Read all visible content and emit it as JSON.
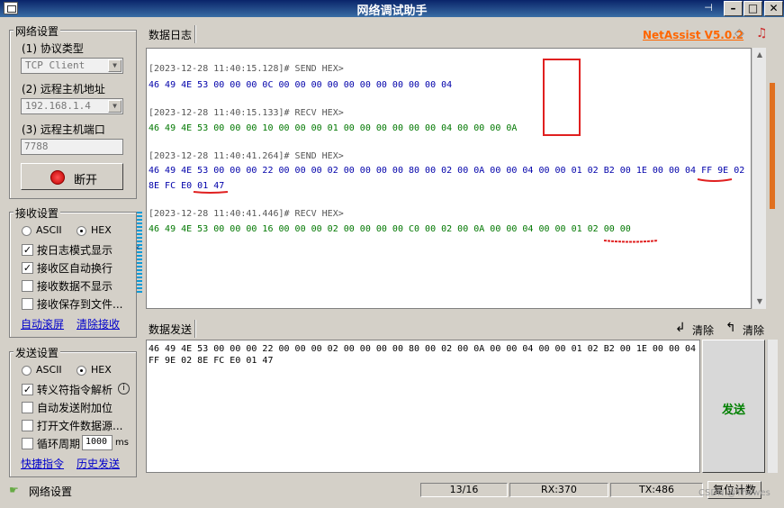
{
  "window": {
    "title": "网络调试助手",
    "minimize": "–",
    "maximize": "□",
    "close": "✕"
  },
  "app_version": "NetAssist V5.0.2",
  "network": {
    "legend": "网络设置",
    "protocol_label": "(1) 协议类型",
    "protocol_value": "TCP Client",
    "host_label": "(2) 远程主机地址",
    "host_value": "192.168.1.4",
    "port_label": "(3) 远程主机端口",
    "port_value": "7788",
    "disconnect_label": "断开"
  },
  "recv_settings": {
    "legend": "接收设置",
    "ascii": "ASCII",
    "hex": "HEX",
    "opt_log_mode": "按日志模式显示",
    "opt_auto_wrap": "接收区自动换行",
    "opt_hide_data": "接收数据不显示",
    "opt_save_file": "接收保存到文件...",
    "auto_scroll": "自动滚屏",
    "clear_recv": "清除接收"
  },
  "send_settings": {
    "legend": "发送设置",
    "ascii": "ASCII",
    "hex": "HEX",
    "opt_escape": "转义符指令解析",
    "opt_checksum": "自动发送附加位",
    "opt_open_file": "打开文件数据源...",
    "opt_cycle": "循环周期",
    "cycle_value": "1000",
    "cycle_unit": "ms",
    "shortcut": "快捷指令",
    "history": "历史发送"
  },
  "log": {
    "tab": "数据日志",
    "entries": [
      {
        "header": "[2023-12-28 11:40:15.128]# SEND HEX>",
        "data": "46 49 4E 53 00 00 00 0C 00 00 00 00 00 00 00 00 00 00 04",
        "dir": "send"
      },
      {
        "header": "[2023-12-28 11:40:15.133]# RECV HEX>",
        "data": "46 49 4E 53 00 00 00 10 00 00 00 01 00 00 00 00 00 00 04 00 00 00 0A",
        "dir": "recv"
      },
      {
        "header": "[2023-12-28 11:40:41.264]# SEND HEX>",
        "data": "46 49 4E 53 00 00 00 22 00 00 00 02 00 00 00 00 80 00 02 00 0A 00 00 04 00 00 01 02 B2 00 1E 00 00 04 FF 9E 02",
        "data2": "8E FC E0 01 47",
        "dir": "send"
      },
      {
        "header": "[2023-12-28 11:40:41.446]# RECV HEX>",
        "data": "46 49 4E 53 00 00 00 16 00 00 00 02 00 00 00 00 C0 00 02 00 0A 00 00 04 00 00 01 02 00 00",
        "dir": "recv"
      }
    ]
  },
  "send": {
    "tab": "数据发送",
    "clear1": "清除",
    "clear2": "清除",
    "text": "46 49 4E 53 00 00 00 22 00 00 00 02 00 00 00 00 80 00 02 00 0A 00 00 04 00 00 01 02 B2 00 1E 00 00 04\nFF 9E 02 8E FC E0 01 47",
    "send_button": "发送"
  },
  "status": {
    "label": "网络设置",
    "count": "13/16",
    "rx": "RX:370",
    "tx": "TX:486",
    "reset": "复位计数",
    "watermark": "CSDN @Thewes"
  },
  "colors": {
    "send": "#0000aa",
    "recv": "#007700",
    "annotation": "#e02020",
    "version": "#ff6600",
    "send_btn": "#008000"
  }
}
